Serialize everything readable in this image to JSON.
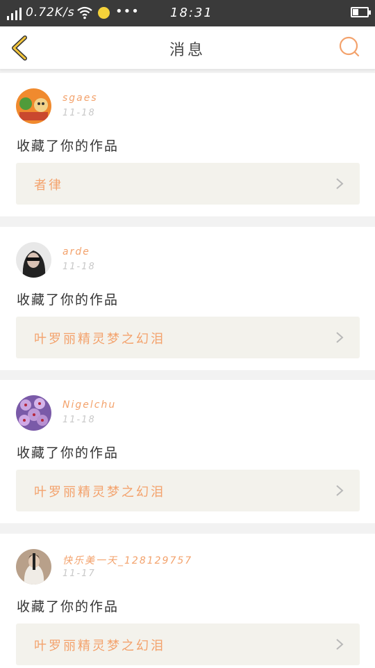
{
  "status_bar": {
    "speed": "0.72K/s",
    "more": "•••",
    "time": "18:31",
    "dot_color": "#f5d23a"
  },
  "header": {
    "title": "消息",
    "back_icon": "chevron-left-icon",
    "search_icon": "search-icon"
  },
  "theme": {
    "accent": "#f3a26c",
    "back_color": "#f2c43b",
    "work_bg": "#f3f2ec"
  },
  "messages": [
    {
      "username": "sgaes",
      "date": "11-18",
      "action": "收藏了你的作品",
      "work_title": "者律"
    },
    {
      "username": "arde",
      "date": "11-18",
      "action": "收藏了你的作品",
      "work_title": "叶罗丽精灵梦之幻泪"
    },
    {
      "username": "Nigelchu",
      "date": "11-18",
      "action": "收藏了你的作品",
      "work_title": "叶罗丽精灵梦之幻泪"
    },
    {
      "username": "快乐美一天_128129757",
      "date": "11-17",
      "action": "收藏了你的作品",
      "work_title": "叶罗丽精灵梦之幻泪"
    }
  ]
}
